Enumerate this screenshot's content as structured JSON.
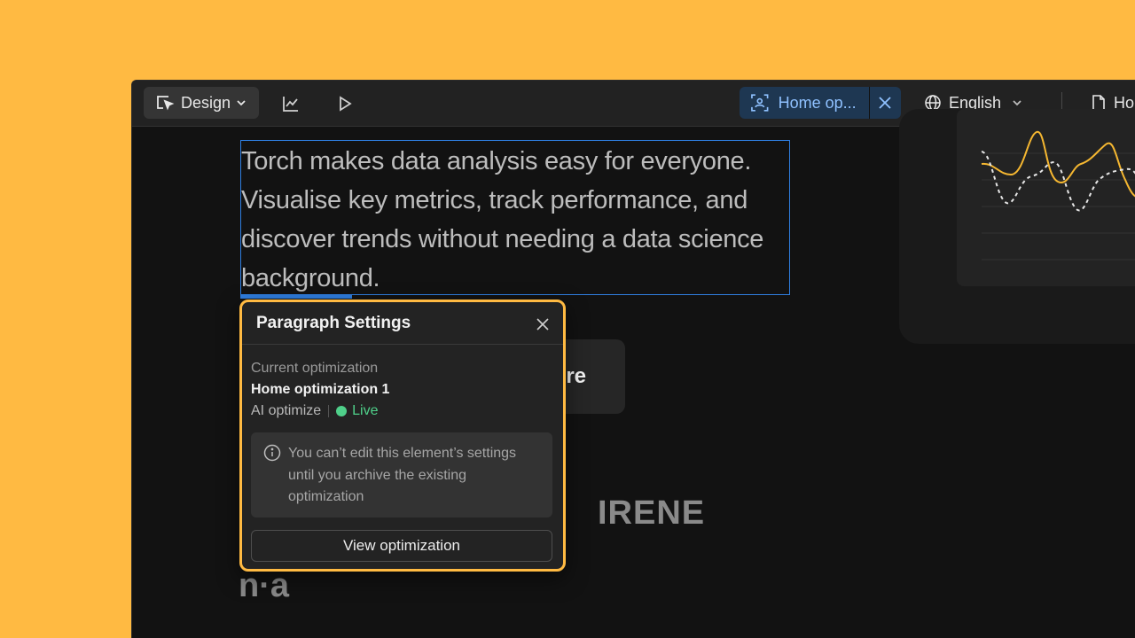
{
  "toolbar": {
    "design_label": "Design",
    "optimization_tab_label": "Home op...",
    "language_label": "English",
    "page_label": "Ho"
  },
  "canvas": {
    "paragraph": "Torch makes data analysis easy for everyone. Visualise key metrics, track performance, and discover trends without needing a data science background.",
    "cta_label": "re",
    "logo_irene": "IRENE",
    "logo_na": "n·a"
  },
  "popover": {
    "title": "Paragraph Settings",
    "current_label": "Current optimization",
    "optimization_name": "Home optimization 1",
    "type": "AI optimize",
    "status": "Live",
    "info_text": "You can’t edit this element’s settings until you archive the existing optimization",
    "button_label": "View optimization"
  },
  "colors": {
    "background": "#FFBA42",
    "accent_blue": "#2f7ee0",
    "live_green": "#4fd08a",
    "chart_orange": "#F5B731"
  }
}
